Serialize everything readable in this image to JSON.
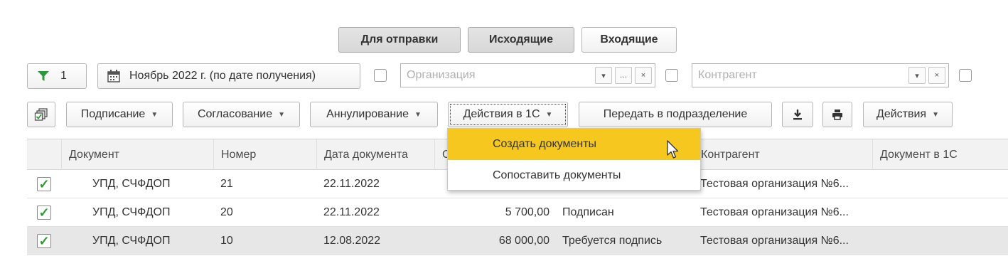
{
  "tabs": {
    "for_send": "Для отправки",
    "outgoing": "Исходящие",
    "incoming": "Входящие"
  },
  "filter": {
    "count": "1",
    "period": "Ноябрь 2022 г. (по дате получения)",
    "organization_placeholder": "Организация",
    "counterparty_placeholder": "Контрагент"
  },
  "toolbar": {
    "signing": "Подписание",
    "approval": "Согласование",
    "annulment": "Аннулирование",
    "actions_1c": "Действия в 1С",
    "transfer": "Передать в подразделение",
    "actions": "Действия"
  },
  "dropdown": {
    "items": [
      "Создать документы",
      "Сопоставить документы"
    ]
  },
  "table": {
    "headers": {
      "document": "Документ",
      "number": "Номер",
      "date": "Дата документа",
      "amount": "С",
      "status": "",
      "counterparty": "Контрагент",
      "doc_1c": "Документ в 1С"
    },
    "rows": [
      {
        "document": "УПД, СЧФДОП",
        "number": "21",
        "date": "22.11.2022",
        "amount": "",
        "status": "",
        "counterparty": "Тестовая организация №6..."
      },
      {
        "document": "УПД, СЧФДОП",
        "number": "20",
        "date": "22.11.2022",
        "amount": "5 700,00",
        "status": "Подписан",
        "counterparty": "Тестовая организация №6..."
      },
      {
        "document": "УПД, СЧФДОП",
        "number": "10",
        "date": "12.08.2022",
        "amount": "68 000,00",
        "status": "Требуется подпись",
        "counterparty": "Тестовая организация №6..."
      }
    ]
  },
  "colors": {
    "accent_yellow": "#f5c71f",
    "check_green": "#2e9b2e"
  }
}
